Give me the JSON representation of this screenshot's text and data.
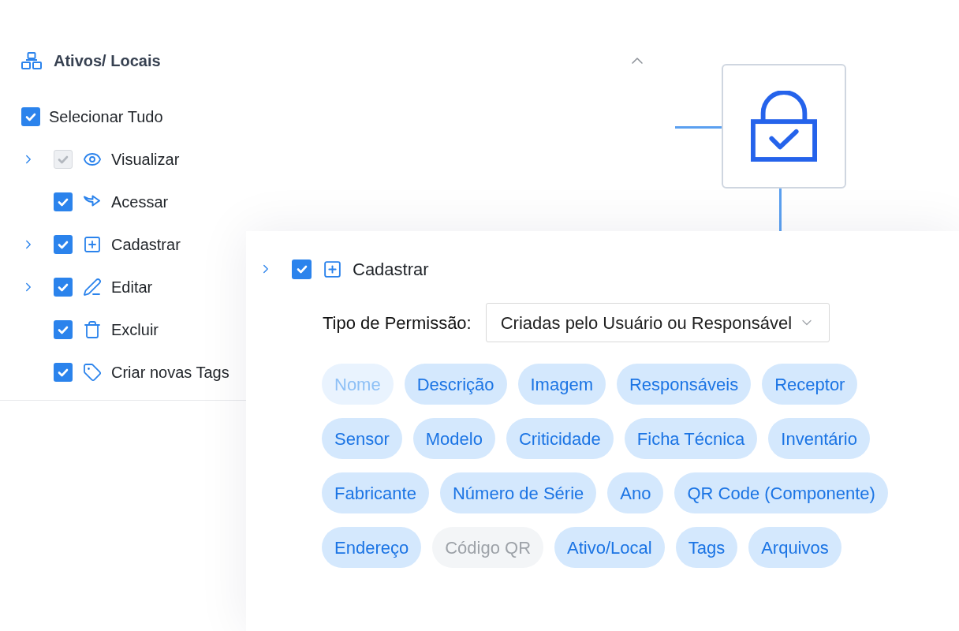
{
  "permission_group": {
    "title": "Ativos/ Locais",
    "expanded": true,
    "select_all": {
      "label": "Selecionar Tudo",
      "checked": true
    },
    "permissions": [
      {
        "kind": "view",
        "label": "Visualizar",
        "checked": true,
        "disabled": true,
        "expandable": true
      },
      {
        "kind": "access",
        "label": "Acessar",
        "checked": true,
        "disabled": false,
        "expandable": false
      },
      {
        "kind": "create",
        "label": "Cadastrar",
        "checked": true,
        "disabled": false,
        "expandable": true
      },
      {
        "kind": "edit",
        "label": "Editar",
        "checked": true,
        "disabled": false,
        "expandable": true
      },
      {
        "kind": "delete",
        "label": "Excluir",
        "checked": true,
        "disabled": false,
        "expandable": false
      },
      {
        "kind": "tag",
        "label": "Criar novas Tags",
        "checked": true,
        "disabled": false,
        "expandable": false
      }
    ]
  },
  "detail": {
    "permission": {
      "kind": "create",
      "label": "Cadastrar",
      "checked": true,
      "expandable": true
    },
    "type_field": {
      "label": "Tipo de Permissão:",
      "value": "Criadas pelo Usuário ou Responsável"
    },
    "fields": [
      {
        "label": "Nome",
        "selected": true,
        "disabled": true
      },
      {
        "label": "Descrição",
        "selected": true,
        "disabled": false
      },
      {
        "label": "Imagem",
        "selected": true,
        "disabled": false
      },
      {
        "label": "Responsáveis",
        "selected": true,
        "disabled": false
      },
      {
        "label": "Receptor",
        "selected": true,
        "disabled": false
      },
      {
        "label": "Sensor",
        "selected": true,
        "disabled": false
      },
      {
        "label": "Modelo",
        "selected": true,
        "disabled": false
      },
      {
        "label": "Criticidade",
        "selected": true,
        "disabled": false
      },
      {
        "label": "Ficha Técnica",
        "selected": true,
        "disabled": false
      },
      {
        "label": "Inventário",
        "selected": true,
        "disabled": false
      },
      {
        "label": "Fabricante",
        "selected": true,
        "disabled": false
      },
      {
        "label": "Número de Série",
        "selected": true,
        "disabled": false
      },
      {
        "label": "Ano",
        "selected": true,
        "disabled": false
      },
      {
        "label": "QR Code (Componente)",
        "selected": true,
        "disabled": false
      },
      {
        "label": "Endereço",
        "selected": true,
        "disabled": false
      },
      {
        "label": "Código QR",
        "selected": false,
        "disabled": true
      },
      {
        "label": "Ativo/Local",
        "selected": true,
        "disabled": false
      },
      {
        "label": "Tags",
        "selected": true,
        "disabled": false
      },
      {
        "label": "Arquivos",
        "selected": true,
        "disabled": false
      }
    ]
  }
}
